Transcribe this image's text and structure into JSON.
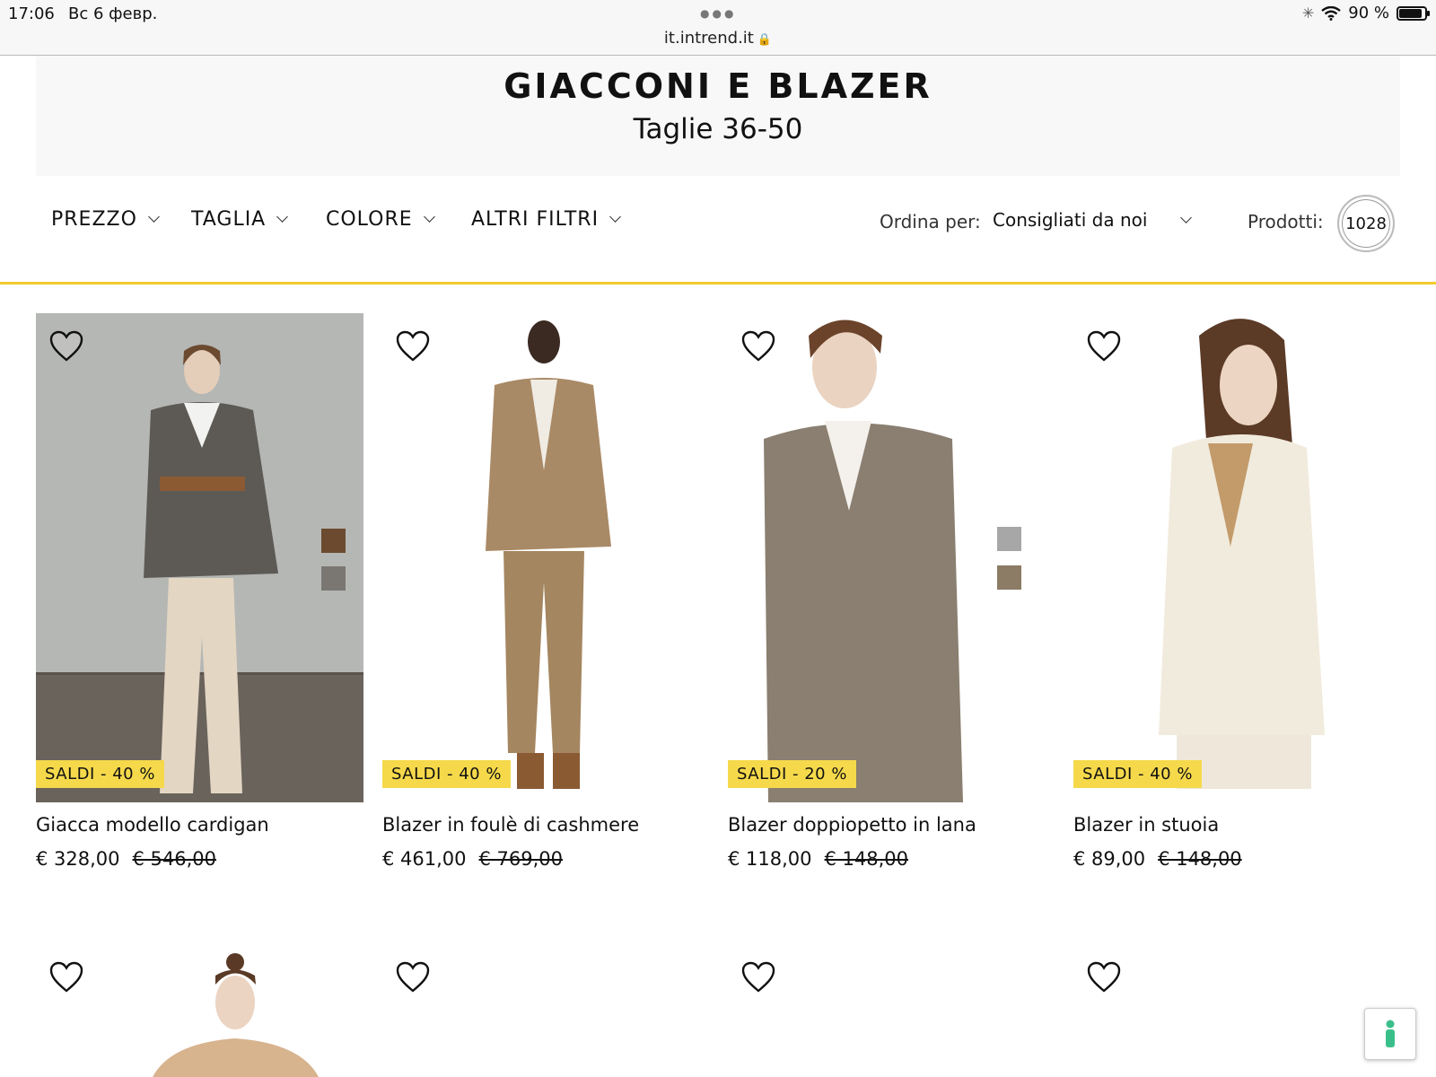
{
  "status_bar": {
    "time": "17:06",
    "date": "Вс 6 февр.",
    "url": "it.intrend.it",
    "battery": "90 %",
    "battery_level": 0.9
  },
  "header": {
    "title": "GIACCONI E BLAZER",
    "subtitle": "Taglie 36-50"
  },
  "filters": [
    {
      "label": "PREZZO"
    },
    {
      "label": "TAGLIA"
    },
    {
      "label": "COLORE"
    },
    {
      "label": "ALTRI FILTRI"
    }
  ],
  "sort": {
    "label": "Ordina per:",
    "value": "Consigliati da noi"
  },
  "products_count": {
    "label": "Prodotti:",
    "value": "1028"
  },
  "colors": {
    "accent": "#f2cb2d",
    "badge": "#f5d94b"
  },
  "products": [
    {
      "name": "Giacca modello cardigan",
      "price": "€ 328,00",
      "old_price": "€ 546,00",
      "badge": "SALDI - 40 %"
    },
    {
      "name": "Blazer in foulè di cashmere",
      "price": "€ 461,00",
      "old_price": "€ 769,00",
      "badge": "SALDI - 40 %"
    },
    {
      "name": "Blazer doppiopetto in lana",
      "price": "€ 118,00",
      "old_price": "€ 148,00",
      "badge": "SALDI - 20 %"
    },
    {
      "name": "Blazer in stuoia",
      "price": "€ 89,00",
      "old_price": "€ 148,00",
      "badge": "SALDI - 40 %"
    }
  ],
  "icons": {
    "wishlist": "heart-icon",
    "help": "person-icon",
    "secure": "lock-icon",
    "wifi": "wifi-icon"
  }
}
